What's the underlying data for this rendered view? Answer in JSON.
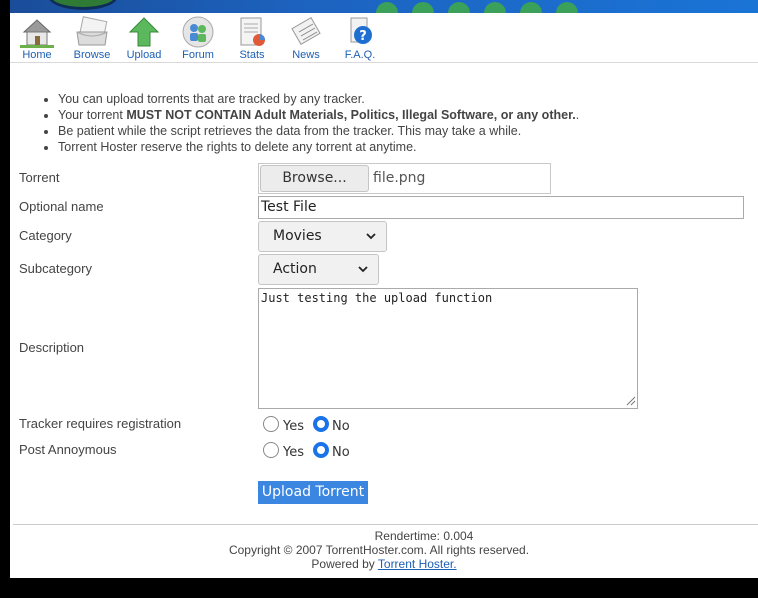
{
  "nav": {
    "items": [
      {
        "label": "Home",
        "icon": "home-icon"
      },
      {
        "label": "Browse",
        "icon": "browse-icon"
      },
      {
        "label": "Upload",
        "icon": "upload-icon"
      },
      {
        "label": "Forum",
        "icon": "forum-icon"
      },
      {
        "label": "Stats",
        "icon": "stats-icon"
      },
      {
        "label": "News",
        "icon": "news-icon"
      },
      {
        "label": "F.A.Q.",
        "icon": "faq-icon"
      }
    ]
  },
  "rules": {
    "line1": "You can upload torrents that are tracked by any tracker.",
    "line2_prefix": "Your torrent ",
    "line2_bold": "MUST NOT CONTAIN Adult Materials, Politics, Illegal Software, or any other.",
    "line2_suffix": ".",
    "line3": "Be patient while the script retrieves the data from the tracker. This may take a while.",
    "line4": "Torrent Hoster reserve the rights to delete any torrent at anytime."
  },
  "form": {
    "torrent_label": "Torrent",
    "browse_label": "Browse...",
    "file_name": "file.png",
    "name_label": "Optional name",
    "name_value": "Test File",
    "category_label": "Category",
    "category_value": "Movies",
    "subcategory_label": "Subcategory",
    "subcategory_value": "Action",
    "description_label": "Description",
    "description_value": "Just testing the upload function",
    "tracker_label": "Tracker requires registration",
    "tracker_yes": "Yes",
    "tracker_no": "No",
    "tracker_selected": "No",
    "anon_label": "Post Annoymous",
    "anon_yes": "Yes",
    "anon_no": "No",
    "anon_selected": "No",
    "submit_label": "Upload Torrent"
  },
  "footer": {
    "rendertime": "Rendertime: 0.004",
    "copyright": "Copyright © 2007 TorrentHoster.com. All rights reserved.",
    "powered_prefix": "Powered by ",
    "powered_link": "Torrent Hoster."
  },
  "colors": {
    "accent": "#3b86e0",
    "link": "#1d5fb3",
    "banner": "#1d63c0"
  }
}
